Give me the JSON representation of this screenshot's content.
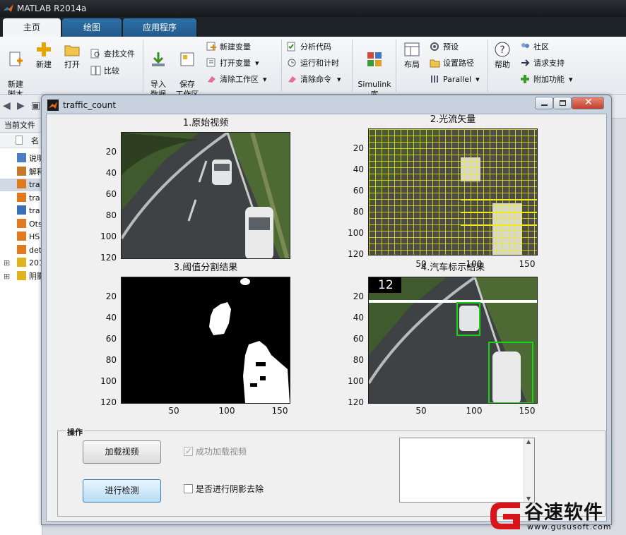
{
  "app": {
    "title": "MATLAB R2014a"
  },
  "tabs": [
    {
      "label": "主页"
    },
    {
      "label": "绘图"
    },
    {
      "label": "应用程序"
    }
  ],
  "ribbon": {
    "new_script": "新建\n脚本",
    "new": "新建",
    "open": "打开",
    "find_files": "查找文件",
    "compare": "比较",
    "import_data": "导入\n数据",
    "save_workspace": "保存\n工作区",
    "new_variable": "新建变量",
    "open_variable": "打开变量",
    "clear_workspace": "清除工作区",
    "analyze_code": "分析代码",
    "run_and_time": "运行和计时",
    "clear_commands": "清除命令",
    "simulink": "Simulink\n库",
    "layout": "布局",
    "preferences": "预设",
    "set_path": "设置路径",
    "parallel": "Parallel",
    "help": "帮助",
    "community": "社区",
    "request_support": "请求支持",
    "add_ons": "附加功能"
  },
  "leftpanel": {
    "title": "当前文件",
    "col_name": "名",
    "files": [
      {
        "name": "说明"
      },
      {
        "name": "解释"
      },
      {
        "name": "tra"
      },
      {
        "name": "tra"
      },
      {
        "name": "tra"
      },
      {
        "name": "Ots"
      },
      {
        "name": "HS"
      },
      {
        "name": "det"
      },
      {
        "name": "201"
      },
      {
        "name": "阴影"
      }
    ]
  },
  "figure": {
    "title": "traffic_count",
    "axes": [
      {
        "title": "1.原始视频"
      },
      {
        "title": "2.光流矢量"
      },
      {
        "title": "3.阈值分割结果"
      },
      {
        "title": "4.汽车标示结果"
      }
    ],
    "yticks": [
      "20",
      "40",
      "60",
      "80",
      "100",
      "120"
    ],
    "xticks": [
      "50",
      "100",
      "150"
    ],
    "count_label": "12",
    "group_title": "操作",
    "load_button": "加载视频",
    "detect_button": "进行检测",
    "loaded_check": "成功加载视频",
    "shadow_check": "是否进行阴影去除"
  },
  "watermark": {
    "name": "谷速软件",
    "url": "www.gususoft.com"
  }
}
